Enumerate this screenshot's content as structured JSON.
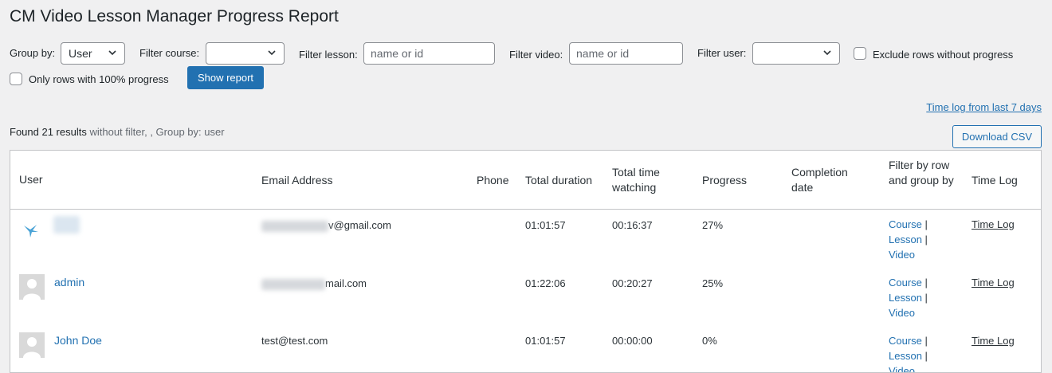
{
  "page": {
    "title": "CM Video Lesson Manager Progress Report"
  },
  "filters": {
    "group_by_label": "Group by:",
    "group_by_value": "User",
    "course_label": "Filter course:",
    "course_value": "",
    "lesson_label": "Filter lesson:",
    "lesson_placeholder": "name or id",
    "video_label": "Filter video:",
    "video_placeholder": "name or id",
    "user_label": "Filter user:",
    "user_value": "",
    "exclude_label": "Exclude rows without progress",
    "only100_label": "Only rows with 100% progress",
    "show_report": "Show report"
  },
  "links": {
    "time_log_7_days": "Time log from last 7 days"
  },
  "results": {
    "found_text": "Found 21 results",
    "filter_text": "without filter, , Group by: user"
  },
  "actions": {
    "download_csv": "Download CSV"
  },
  "table": {
    "headers": {
      "user": "User",
      "email": "Email Address",
      "phone": "Phone",
      "total_duration": "Total duration",
      "total_time_watching": "Total time watching",
      "progress": "Progress",
      "completion_date": "Completion date",
      "filter_by_row": "Filter by row and group by",
      "time_log": "Time Log"
    },
    "rows": [
      {
        "name": "",
        "email": "v@gmail.com",
        "phone": "",
        "total_duration": "01:01:57",
        "watching": "00:16:37",
        "progress": "27%",
        "completion": "",
        "course": "Course",
        "lesson": "Lesson",
        "video": "Video",
        "sep": "|",
        "time_log": "Time Log"
      },
      {
        "name": "admin",
        "email": "mail.com",
        "phone": "",
        "total_duration": "01:22:06",
        "watching": "00:20:27",
        "progress": "25%",
        "completion": "",
        "course": "Course",
        "lesson": "Lesson",
        "video": "Video",
        "sep": "|",
        "time_log": "Time Log"
      },
      {
        "name": "John Doe",
        "email": "test@test.com",
        "phone": "",
        "total_duration": "01:01:57",
        "watching": "00:00:00",
        "progress": "0%",
        "completion": "",
        "course": "Course",
        "lesson": "Lesson",
        "video": "Video",
        "sep": "|",
        "time_log": "Time Log"
      }
    ]
  },
  "colors": {
    "accent": "#2271b1",
    "background": "#f0f0f1",
    "text": "#1d2327"
  }
}
